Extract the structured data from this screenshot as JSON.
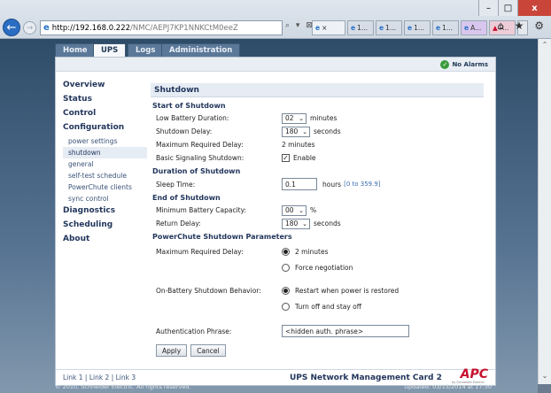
{
  "browser": {
    "url_host": "http://192.168.0.222",
    "url_path": "/NMC/AEPJ7KP1NNKCtM0eeZ",
    "addr_tools": "⌕ ▾ ⊠ ↻",
    "tabs": [
      {
        "label": "×",
        "active": true
      },
      {
        "label": "1..."
      },
      {
        "label": "1..."
      },
      {
        "label": "1..."
      },
      {
        "label": "1..."
      },
      {
        "label": "A..."
      },
      {
        "label": "P..."
      }
    ],
    "window_controls": [
      "–",
      "□",
      "x"
    ],
    "right_tools": "⌂ ★ ⚙"
  },
  "nav_tabs": [
    "Home",
    "UPS",
    "Logs",
    "Administration"
  ],
  "status": {
    "alarm_text": "No Alarms"
  },
  "sidebar": {
    "overview": "Overview",
    "status": "Status",
    "control": "Control",
    "configuration": "Configuration",
    "sub": [
      "power settings",
      "shutdown",
      "general",
      "self-test schedule",
      "PowerChute clients",
      "sync control"
    ],
    "diagnostics": "Diagnostics",
    "scheduling": "Scheduling",
    "about": "About"
  },
  "form": {
    "title": "Shutdown",
    "start_section": "Start of Shutdown",
    "low_battery_label": "Low Battery Duration:",
    "low_battery_value": "02",
    "low_battery_unit": "minutes",
    "shutdown_delay_label": "Shutdown Delay:",
    "shutdown_delay_value": "180",
    "shutdown_delay_unit": "seconds",
    "max_delay_label": "Maximum Required Delay:",
    "max_delay_value": "2 minutes",
    "basic_signal_label": "Basic Signaling Shutdown:",
    "basic_signal_check": "Enable",
    "duration_section": "Duration of Shutdown",
    "sleep_label": "Sleep Time:",
    "sleep_value": "0.1",
    "sleep_unit": "hours",
    "sleep_hint": "[0 to 359.9]",
    "end_section": "End of Shutdown",
    "min_batt_label": "Minimum Battery Capacity:",
    "min_batt_value": "00",
    "min_batt_unit": "%",
    "return_label": "Return Delay:",
    "return_value": "180",
    "return_unit": "seconds",
    "pc_section": "PowerChute Shutdown Parameters",
    "pc_max_label": "Maximum Required Delay:",
    "pc_max_opt1": "2 minutes",
    "pc_max_opt2": "Force negotiation",
    "onbatt_label": "On-Battery Shutdown Behavior:",
    "onbatt_opt1": "Restart when power is restored",
    "onbatt_opt2": "Turn off and stay off",
    "auth_label": "Authentication Phrase:",
    "auth_value": "<hidden auth. phrase>",
    "apply": "Apply",
    "cancel": "Cancel"
  },
  "footer": {
    "link1": "Link 1",
    "link2": "Link 2",
    "link3": "Link 3",
    "product": "UPS Network Management Card 2",
    "logo": "APC",
    "logo_sub": "by Schneider Electric",
    "copyright": "© 2010, Schneider Electric. All rights reserved.",
    "updated": "Updated: 03/15/2014 at 17:30"
  }
}
